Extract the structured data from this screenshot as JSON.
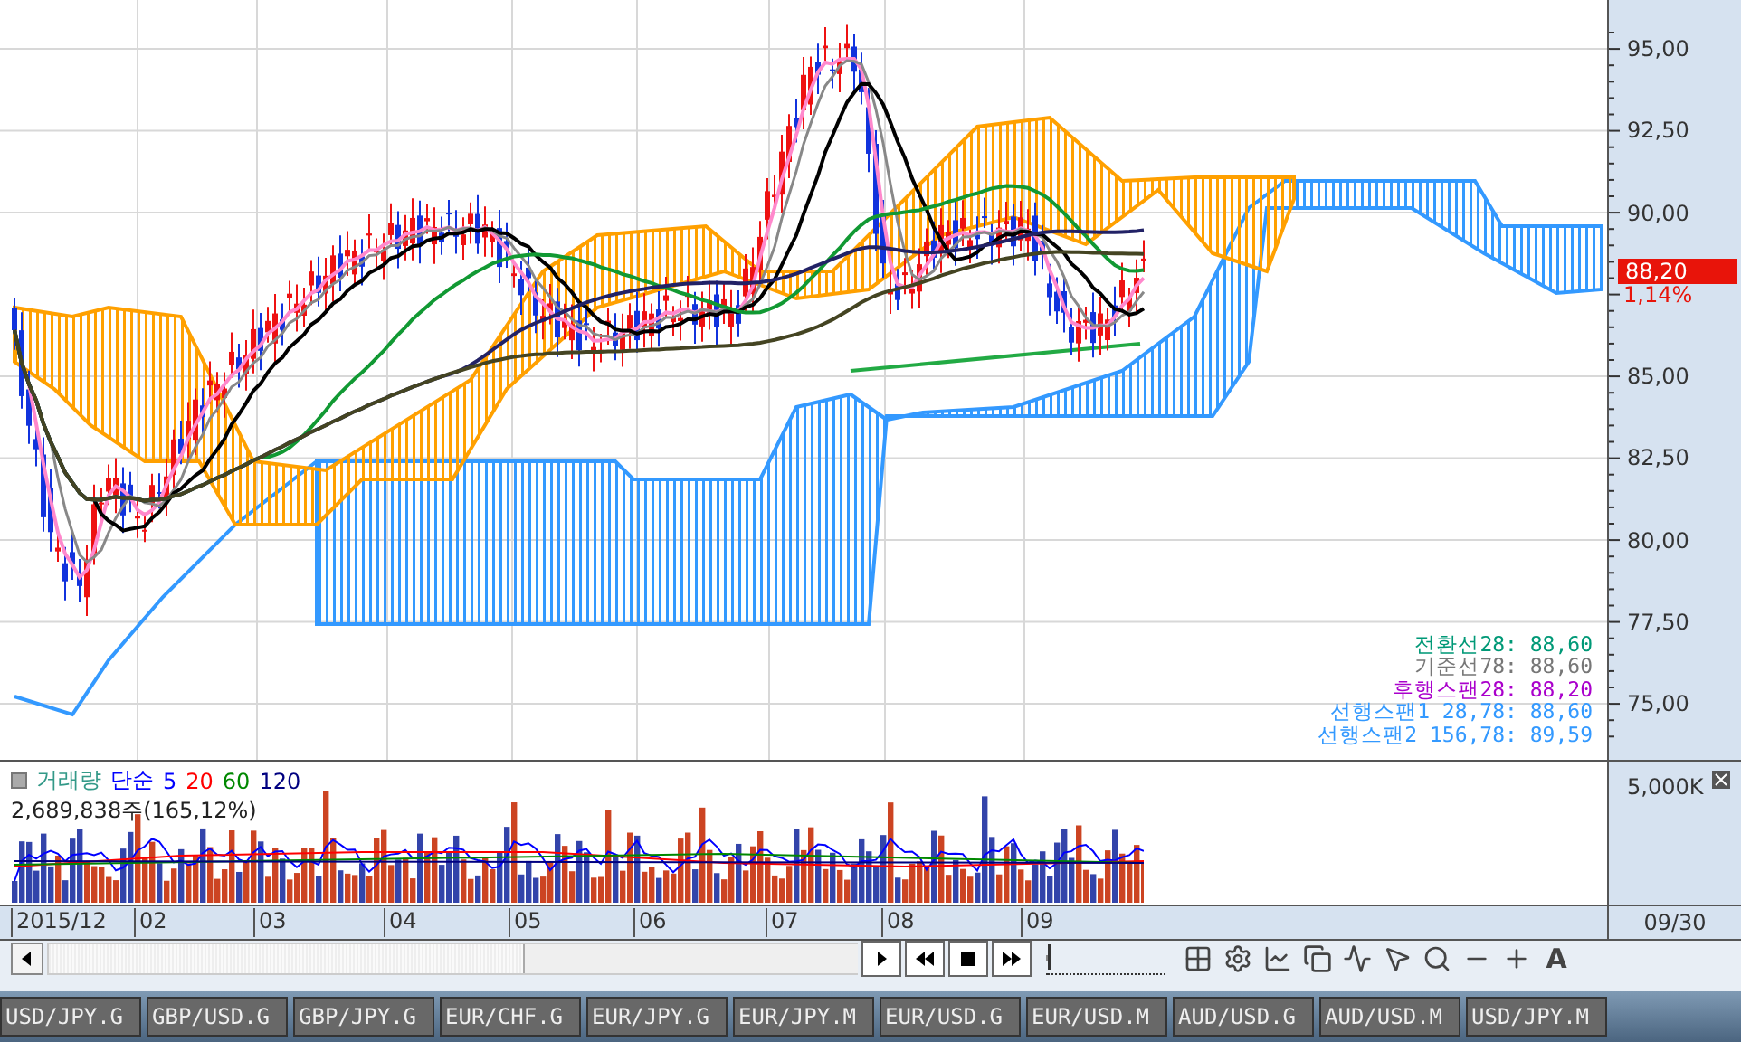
{
  "chart": {
    "y_ticks": [
      "95,00",
      "92,50",
      "90,00",
      "85,00",
      "82,50",
      "80,00",
      "77,50",
      "75,00"
    ],
    "price_tag": "88,20",
    "change": "1,14%",
    "legend": [
      {
        "text": "전환선28: 88,60",
        "color": "#009977"
      },
      {
        "text": "기준선78: 88,60",
        "color": "#777777"
      },
      {
        "text": "후행스팬28: 88,20",
        "color": "#aa00cc"
      },
      {
        "text": "선행스팬1 28,78: 88,60",
        "color": "#3399ff"
      },
      {
        "text": "선행스팬2 156,78: 89,59",
        "color": "#3399ff"
      }
    ]
  },
  "volume": {
    "title": "거래량",
    "ma_type": "단순",
    "periods": [
      {
        "text": "5",
        "color": "#0000ff"
      },
      {
        "text": "20",
        "color": "#ff0000"
      },
      {
        "text": "60",
        "color": "#008800"
      },
      {
        "text": "120",
        "color": "#000080"
      }
    ],
    "reading": "2,689,838주(165,12%)",
    "axis_label": "5,000K"
  },
  "date_axis": {
    "labels": [
      "2015/12",
      "02",
      "03",
      "04",
      "05",
      "06",
      "07",
      "08",
      "09"
    ],
    "end_label": "09/30"
  },
  "toolbar": {
    "zoom_slider": {
      "level": 0.02
    },
    "font_button": "A"
  },
  "tabs": [
    "USD/JPY.G",
    "GBP/USD.G",
    "GBP/JPY.G",
    "EUR/CHF.G",
    "EUR/JPY.G",
    "EUR/JPY.M",
    "EUR/USD.G",
    "EUR/USD.M",
    "AUD/USD.G",
    "AUD/USD.M",
    "USD/JPY.M"
  ]
}
